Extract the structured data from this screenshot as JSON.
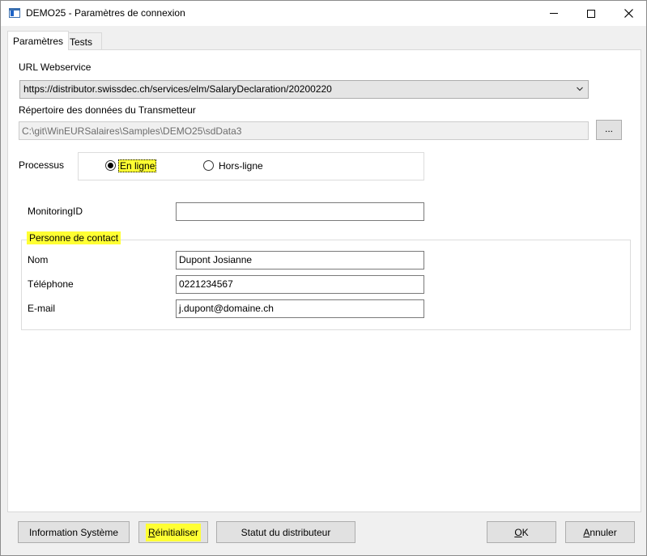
{
  "window": {
    "title": "DEMO25 - Paramètres de connexion",
    "controls": [
      "minimize",
      "maximize",
      "close"
    ]
  },
  "tabs": [
    {
      "label": "Paramètres",
      "active": true
    },
    {
      "label": "Tests",
      "active": false
    }
  ],
  "form": {
    "url_label": "URL Webservice",
    "url_value": "https://distributor.swissdec.ch/services/elm/SalaryDeclaration/20200220",
    "dir_label": "Répertoire des données du Transmetteur",
    "dir_value": "C:\\git\\WinEURSalaires\\Samples\\DEMO25\\sdData3",
    "browse_label": "...",
    "process_label": "Processus",
    "process_options": [
      {
        "label": "En ligne",
        "checked": true
      },
      {
        "label": "Hors-ligne",
        "checked": false
      }
    ],
    "monitoring_label": "MonitoringID",
    "monitoring_value": ""
  },
  "contact": {
    "legend": "Personne de contact",
    "fields": [
      {
        "label": "Nom",
        "value": "Dupont Josianne"
      },
      {
        "label": "Téléphone",
        "value": "0221234567"
      },
      {
        "label": "E-mail",
        "value": "j.dupont@domaine.ch"
      }
    ]
  },
  "buttons": {
    "info": "Information Système",
    "reset": "Réinitialiser",
    "status": "Statut du distributeur",
    "ok": "OK",
    "cancel": "Annuler"
  },
  "colors": {
    "highlight": "#ffff33",
    "window_bg": "#f0f0f0",
    "panel_bg": "#ffffff",
    "button_bg": "#e1e1e1"
  },
  "icons": {
    "app": "app-window-icon",
    "minimize": "minimize-icon",
    "maximize": "maximize-icon",
    "close": "close-icon",
    "dropdown": "chevron-down-icon"
  }
}
